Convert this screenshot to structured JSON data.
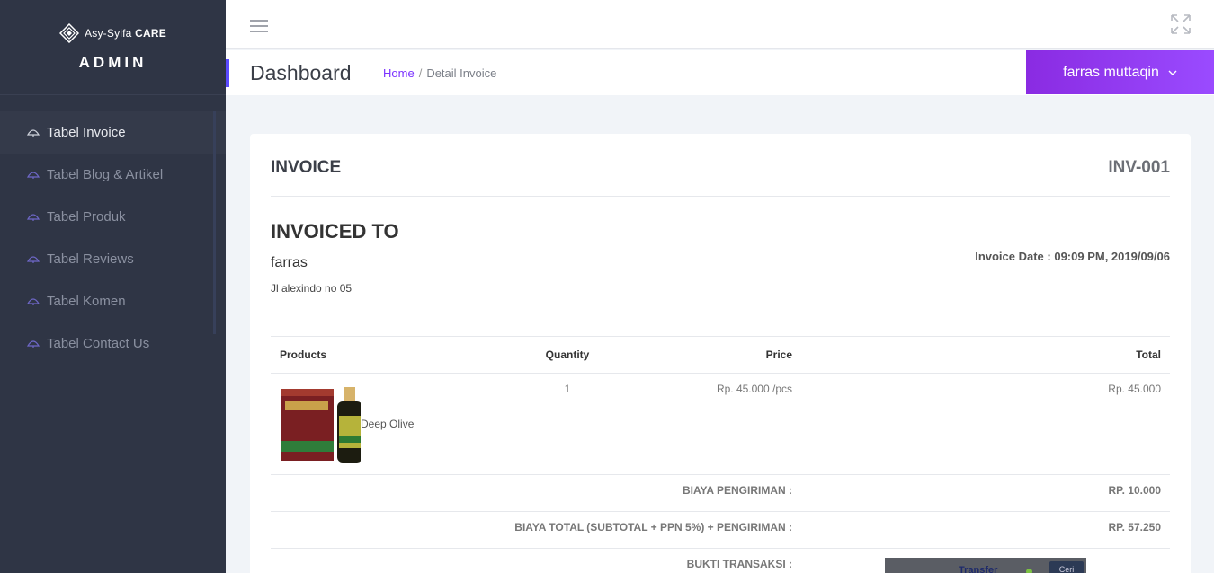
{
  "brand": {
    "logo_text_light": "Asy-Syifa",
    "logo_text_bold": "CARE",
    "title": "ADMIN"
  },
  "sidebar": {
    "items": [
      {
        "label": "Tabel Invoice",
        "active": true
      },
      {
        "label": "Tabel Blog & Artikel"
      },
      {
        "label": "Tabel Produk"
      },
      {
        "label": "Tabel Reviews"
      },
      {
        "label": "Tabel Komen"
      },
      {
        "label": "Tabel Contact Us"
      }
    ]
  },
  "header": {
    "title": "Dashboard",
    "breadcrumb": {
      "home": "Home",
      "separator": "/",
      "current": "Detail Invoice"
    },
    "user": "farras muttaqin"
  },
  "invoice": {
    "heading": "INVOICE",
    "number": "INV-001",
    "to_heading": "INVOICED TO",
    "customer_name": "farras",
    "customer_address": "Jl alexindo no 05",
    "date": "Invoice Date : 09:09 PM, 2019/09/06",
    "columns": {
      "products": "Products",
      "quantity": "Quantity",
      "price": "Price",
      "total": "Total"
    },
    "items": [
      {
        "name": "Deep Olive",
        "quantity": "1",
        "price": "Rp. 45.000 /pcs",
        "total": "Rp. 45.000"
      }
    ],
    "shipping_label": "BIAYA PENGIRIMAN :",
    "shipping_value": "RP. 10.000",
    "total_label": "BIAYA TOTAL (SUBTOTAL + PPN 5%) + PENGIRIMAN :",
    "total_value": "RP. 57.250",
    "proof_label": "BUKTI TRANSAKSI :",
    "proof_image_text": "Transfer",
    "proof_image_button": "Ceri"
  },
  "colors": {
    "sidebar_bg": "#2f3545",
    "accent": "#5b4bff",
    "user_btn": "#8a2be2",
    "link": "#7b32ff"
  }
}
